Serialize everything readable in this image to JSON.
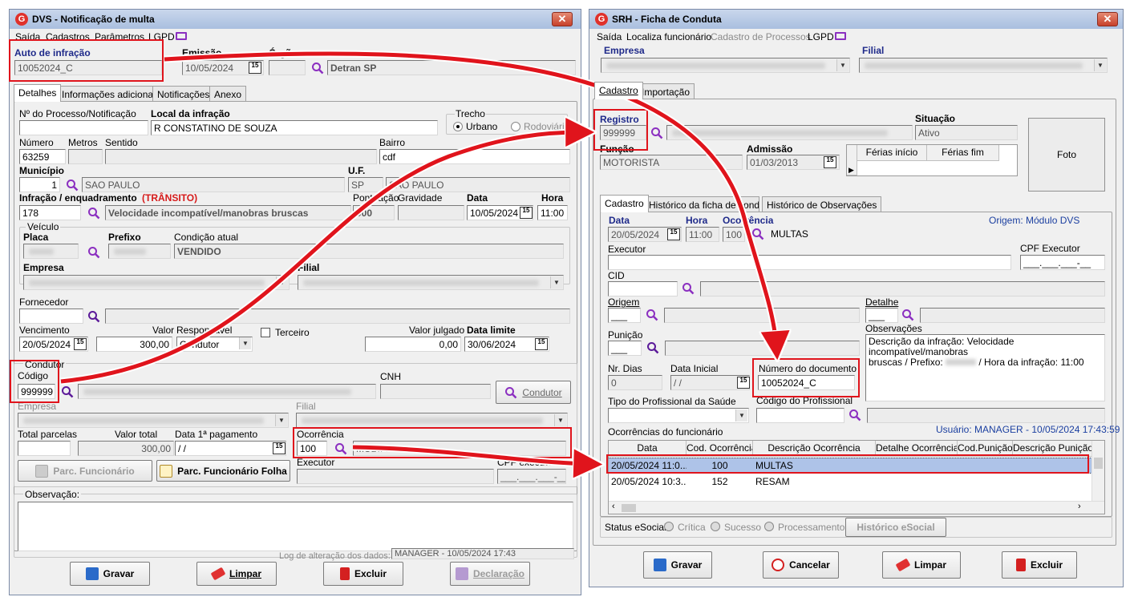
{
  "colors": {
    "highlight": "#e0141c",
    "accent": "#8b2fc0",
    "titlebar": "#b9cde8"
  },
  "dvs": {
    "title": "DVS - Notificação de multa",
    "close": "✕",
    "menu": [
      "Saída",
      "Cadastros",
      "Parâmetros",
      "LGPD"
    ],
    "auto_label": "Auto de infração",
    "auto_value": "10052024_C",
    "emissao_label": "Emissão",
    "emissao_value": "10/05/2024",
    "orgao_label": "Órgão",
    "orgao_value": "Detran SP",
    "tabs": [
      "Detalhes",
      "Informações adicionais",
      "Notificações",
      "Anexo"
    ],
    "processo_label": "Nº do Processo/Notificação",
    "local_label": "Local da infração",
    "local_value": "R CONSTATINO DE SOUZA",
    "trecho_label": "Trecho",
    "urbano": "Urbano",
    "rodoviario": "Rodoviário",
    "numero_label": "Número",
    "numero_value": "63259",
    "metros_label": "Metros",
    "sentido_label": "Sentido",
    "bairro_label": "Bairro",
    "bairro_value": "cdf",
    "municipio_label": "Município",
    "municipio_code": "1",
    "municipio_name": "SAO PAULO",
    "uf_label": "U.F.",
    "uf_value": "SP",
    "uf_name": "SAO PAULO",
    "infracao_label": "Infração / enquadramento",
    "infracao_tag": "(TRÂNSITO)",
    "infracao_code": "178",
    "infracao_desc": "Velocidade incompatível/manobras bruscas",
    "pontuacao_label": "Pontuação",
    "pontuacao_value": "000",
    "gravidade_label": "Gravidade",
    "data_label": "Data",
    "data_value": "10/05/2024",
    "hora_label": "Hora",
    "hora_value": "11:00",
    "veiculo_label": "Veículo",
    "placa_label": "Placa",
    "prefixo_label": "Prefixo",
    "condicao_label": "Condição atual",
    "condicao_value": "VENDIDO",
    "empresa_label": "Empresa",
    "filial_label": "Filial",
    "fornecedor_label": "Fornecedor",
    "vencimento_label": "Vencimento",
    "vencimento_value": "20/05/2024",
    "valor_label": "Valor",
    "valor_value": "300,00",
    "responsavel_label": "Responsável",
    "responsavel_value": "Condutor",
    "terceiro_label": "Terceiro",
    "valor_julgado_label": "Valor julgado",
    "valor_julgado_value": "0,00",
    "data_limite_label": "Data limite",
    "data_limite_value": "30/06/2024",
    "condutor_label": "Condutor",
    "codigo_label": "Código",
    "codigo_value": "999999",
    "cnh_label": "CNH",
    "condutor_button": "Condutor",
    "empresa2_label": "Empresa",
    "filial2_label": "Filial",
    "total_parcelas_label": "Total parcelas",
    "valor_total_label": "Valor total",
    "valor_total_value": "300,00",
    "data_pagamento_label": "Data 1ª pagamento",
    "data_pagamento_value": "/ /",
    "ocorrencia_label": "Ocorrência",
    "ocorrencia_code": "100",
    "ocorrencia_desc": "MULTAS",
    "executor_label": "Executor",
    "cpf_executor_label": "CPF executor",
    "cpf_value": "___.___.___-__",
    "parc_funcionario": "Parc. Funcionário",
    "parc_folha": "Parc. Funcionário Folha",
    "observacao_label": "Observação:",
    "log_label": "Log de alteração dos dados:",
    "log_value": "MANAGER - 10/05/2024 17:43",
    "buttons": {
      "gravar": "Gravar",
      "limpar": "Limpar",
      "excluir": "Excluir",
      "declaracao": "Declaração"
    }
  },
  "srh": {
    "title": "SRH - Ficha de Conduta",
    "close": "✕",
    "menu": [
      "Saída",
      "Localiza funcionário",
      "Cadastro de Processos",
      "LGPD"
    ],
    "empresa_label": "Empresa",
    "filial_label": "Filial",
    "tabs": [
      "Cadastro",
      "Importação"
    ],
    "registro_label": "Registro",
    "registro_value": "999999",
    "situacao_label": "Situação",
    "situacao_value": "Ativo",
    "funcao_label": "Função",
    "funcao_value": "MOTORISTA",
    "admissao_label": "Admissão",
    "admissao_value": "01/03/2013",
    "ferias_inicio": "Férias início",
    "ferias_fim": "Férias fim",
    "foto": "Foto",
    "subtabs": [
      "Cadastro",
      "Histórico da ficha de conduta",
      "Histórico de Observações"
    ],
    "data_label": "Data",
    "data_value": "20/05/2024",
    "hora_label": "Hora",
    "hora_value": "11:00",
    "ocorrencia_label": "Ocorrência",
    "ocorrencia_code": "100",
    "ocorrencia_desc": "MULTAS",
    "origem_modulo": "Origem: Módulo DVS",
    "executor_label": "Executor",
    "cpf_executor_label": "CPF Executor",
    "cpf_value": "___.___.___-__",
    "cid_label": "CID",
    "origem_label": "Origem",
    "detalhe_label": "Detalhe",
    "punicao_label": "Punição",
    "observacoes_label": "Observações",
    "obs_line1": "Descrição da infração: Velocidade incompatível/manobras",
    "obs_line2a": "bruscas / Prefixo:",
    "obs_line2b": "/ Hora da infração: 11:00",
    "nr_dias_label": "Nr. Dias",
    "nr_dias_value": "0",
    "data_inicial_label": "Data Inicial",
    "data_inicial_value": "/ /",
    "numero_doc_label": "Número do documento",
    "numero_doc_value": "10052024_C",
    "tipo_prof_label": "Tipo do Profissional da Saúde",
    "codigo_prof_label": "Código do Profissional",
    "ocorrencias_label": "Ocorrências do funcionário",
    "usuario": "Usuário: MANAGER - 10/05/2024 17:43:59",
    "grid_headers": [
      "Data",
      "Cod. Ocorrência",
      "Descrição Ocorrência",
      "Detalhe Ocorrência",
      "Cod.Punição",
      "Descrição Punição"
    ],
    "grid_rows": [
      {
        "data": "20/05/2024 11:0...",
        "cod": "100",
        "desc": "MULTAS"
      },
      {
        "data": "20/05/2024 10:3...",
        "cod": "152",
        "desc": "RESAM"
      }
    ],
    "status_label": "Status eSocial:",
    "critica": "Crítica",
    "sucesso": "Sucesso",
    "processamento": "Processamento",
    "historico_esocial": "Histórico eSocial",
    "buttons": {
      "gravar": "Gravar",
      "cancelar": "Cancelar",
      "limpar": "Limpar",
      "excluir": "Excluir"
    }
  }
}
